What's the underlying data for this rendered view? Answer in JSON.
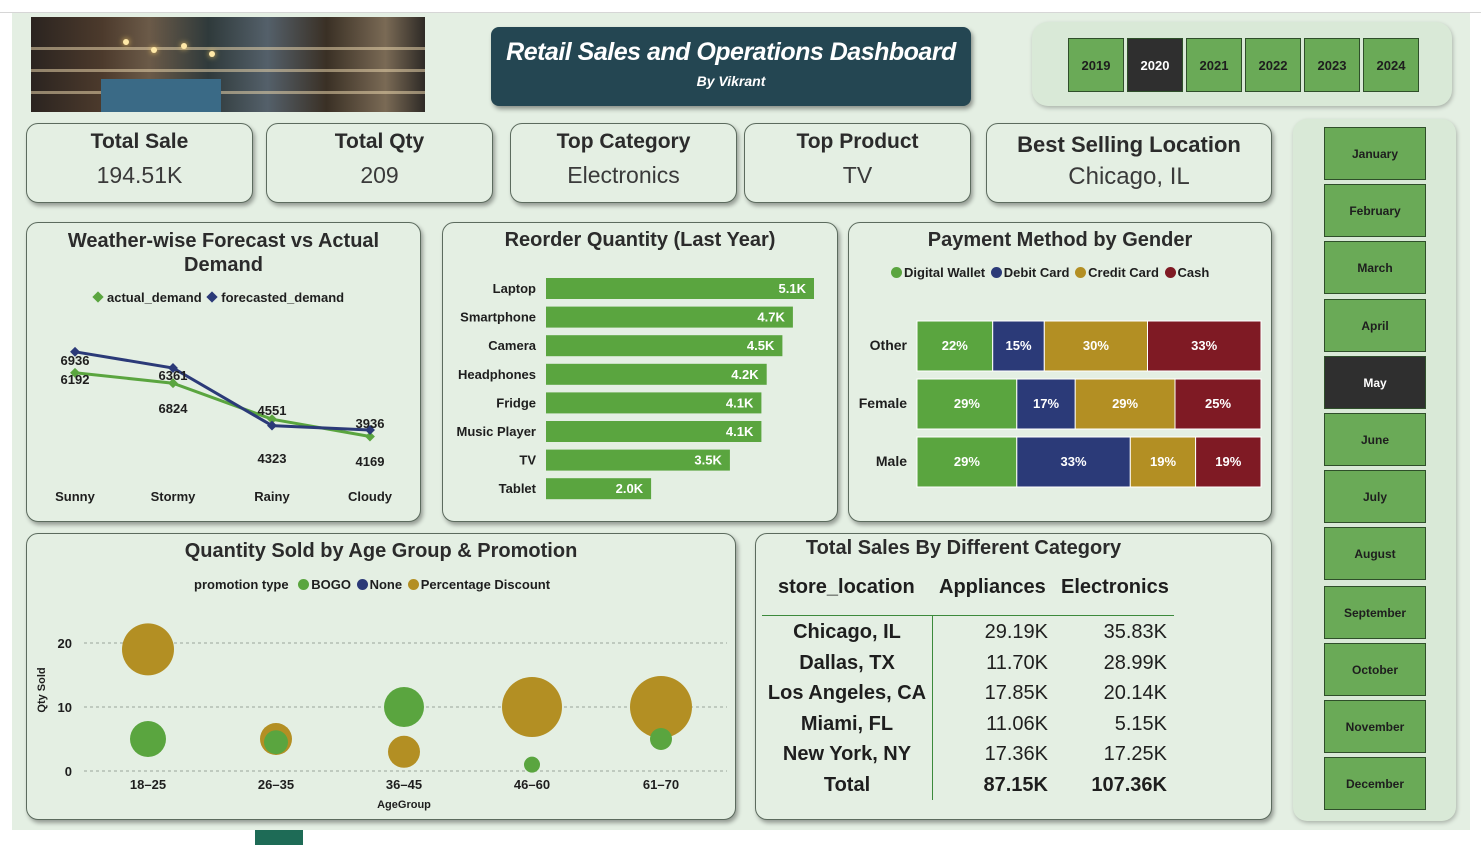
{
  "header": {
    "title": "Retail Sales and Operations Dashboard",
    "subtitle": "By Vikrant"
  },
  "years": {
    "items": [
      "2019",
      "2020",
      "2021",
      "2022",
      "2023",
      "2024"
    ],
    "selected": "2020"
  },
  "months": {
    "items": [
      "January",
      "February",
      "March",
      "April",
      "May",
      "June",
      "July",
      "August",
      "September",
      "October",
      "November",
      "December"
    ],
    "selected": "May"
  },
  "kpis": [
    {
      "title": "Total Sale",
      "value": "194.51K"
    },
    {
      "title": "Total Qty",
      "value": "209"
    },
    {
      "title": "Top Category",
      "value": "Electronics"
    },
    {
      "title": "Top Product",
      "value": "TV"
    },
    {
      "title": "Best Selling Location",
      "value": "Chicago, IL"
    }
  ],
  "chart_data": [
    {
      "type": "line",
      "title": "Weather-wise Forecast vs Actual Demand",
      "categories": [
        "Sunny",
        "Stormy",
        "Rainy",
        "Cloudy"
      ],
      "series": [
        {
          "name": "actual_demand",
          "color": "#5aa53f",
          "values": [
            6192,
            5824,
            4551,
            3936
          ],
          "labels": [
            "6192",
            "6824",
            "4551",
            "3936"
          ]
        },
        {
          "name": "forecasted_demand",
          "color": "#2b3a78",
          "values": [
            6936,
            6361,
            4323,
            4169
          ],
          "labels": [
            "6936",
            "6361",
            "4323",
            "4169"
          ]
        }
      ],
      "ylim": [
        3000,
        7600
      ]
    },
    {
      "type": "bar",
      "orientation": "horizontal",
      "title": "Reorder Quantity (Last Year)",
      "categories": [
        "Laptop",
        "Smartphone",
        "Camera",
        "Headphones",
        "Fridge",
        "Music Player",
        "TV",
        "Tablet"
      ],
      "values": [
        5100,
        4700,
        4500,
        4200,
        4100,
        4100,
        3500,
        2000
      ],
      "data_labels": [
        "5.1K",
        "4.7K",
        "4.5K",
        "4.2K",
        "4.1K",
        "4.1K",
        "3.5K",
        "2.0K"
      ],
      "color": "#5aa53f",
      "xlim": [
        0,
        5900
      ]
    },
    {
      "type": "bar",
      "orientation": "horizontal",
      "stacked": "percent",
      "title": "Payment Method by Gender",
      "categories": [
        "Other",
        "Female",
        "Male"
      ],
      "series": [
        {
          "name": "Digital Wallet",
          "color": "#5aa53f",
          "values": [
            22,
            29,
            29
          ]
        },
        {
          "name": "Debit Card",
          "color": "#2b3a78",
          "values": [
            15,
            17,
            33
          ]
        },
        {
          "name": "Credit Card",
          "color": "#b38f23",
          "values": [
            30,
            29,
            19
          ]
        },
        {
          "name": "Cash",
          "color": "#7f1a24",
          "values": [
            33,
            25,
            19
          ]
        }
      ],
      "legend": "top"
    },
    {
      "type": "scatter",
      "title": "Quantity Sold by Age Group & Promotion",
      "legend_title": "promotion type",
      "xlabel": "AgeGroup",
      "ylabel": "Qty Sold",
      "categories": [
        "18–25",
        "26–35",
        "36–45",
        "46–60",
        "61–70"
      ],
      "ylim": [
        0,
        23
      ],
      "yticks": [
        0,
        10,
        20
      ],
      "grid": true,
      "series": [
        {
          "name": "BOGO",
          "color": "#5aa53f",
          "points": [
            {
              "x": "18–25",
              "y": 5,
              "size": 18
            },
            {
              "x": "26–35",
              "y": 4.5,
              "size": 12
            },
            {
              "x": "36–45",
              "y": 10,
              "size": 20
            },
            {
              "x": "46–60",
              "y": 1,
              "size": 8
            },
            {
              "x": "61–70",
              "y": 5,
              "size": 11
            }
          ]
        },
        {
          "name": "None",
          "color": "#2b3a78",
          "points": []
        },
        {
          "name": "Percentage Discount",
          "color": "#b38f23",
          "points": [
            {
              "x": "18–25",
              "y": 19,
              "size": 26
            },
            {
              "x": "26–35",
              "y": 5,
              "size": 16
            },
            {
              "x": "36–45",
              "y": 3,
              "size": 16
            },
            {
              "x": "46–60",
              "y": 10,
              "size": 30
            },
            {
              "x": "61–70",
              "y": 10,
              "size": 31
            }
          ]
        }
      ]
    },
    {
      "type": "table",
      "title": "Total Sales By Different Category",
      "columns": [
        "store_location",
        "Appliances",
        "Electronics"
      ],
      "rows": [
        [
          "Chicago, IL",
          "29.19K",
          "35.83K"
        ],
        [
          "Dallas, TX",
          "11.70K",
          "28.99K"
        ],
        [
          "Los Angeles, CA",
          "17.85K",
          "20.14K"
        ],
        [
          "Miami, FL",
          "11.06K",
          "5.15K"
        ],
        [
          "New York, NY",
          "17.36K",
          "17.25K"
        ]
      ],
      "total": [
        "Total",
        "87.15K",
        "107.36K"
      ]
    }
  ]
}
